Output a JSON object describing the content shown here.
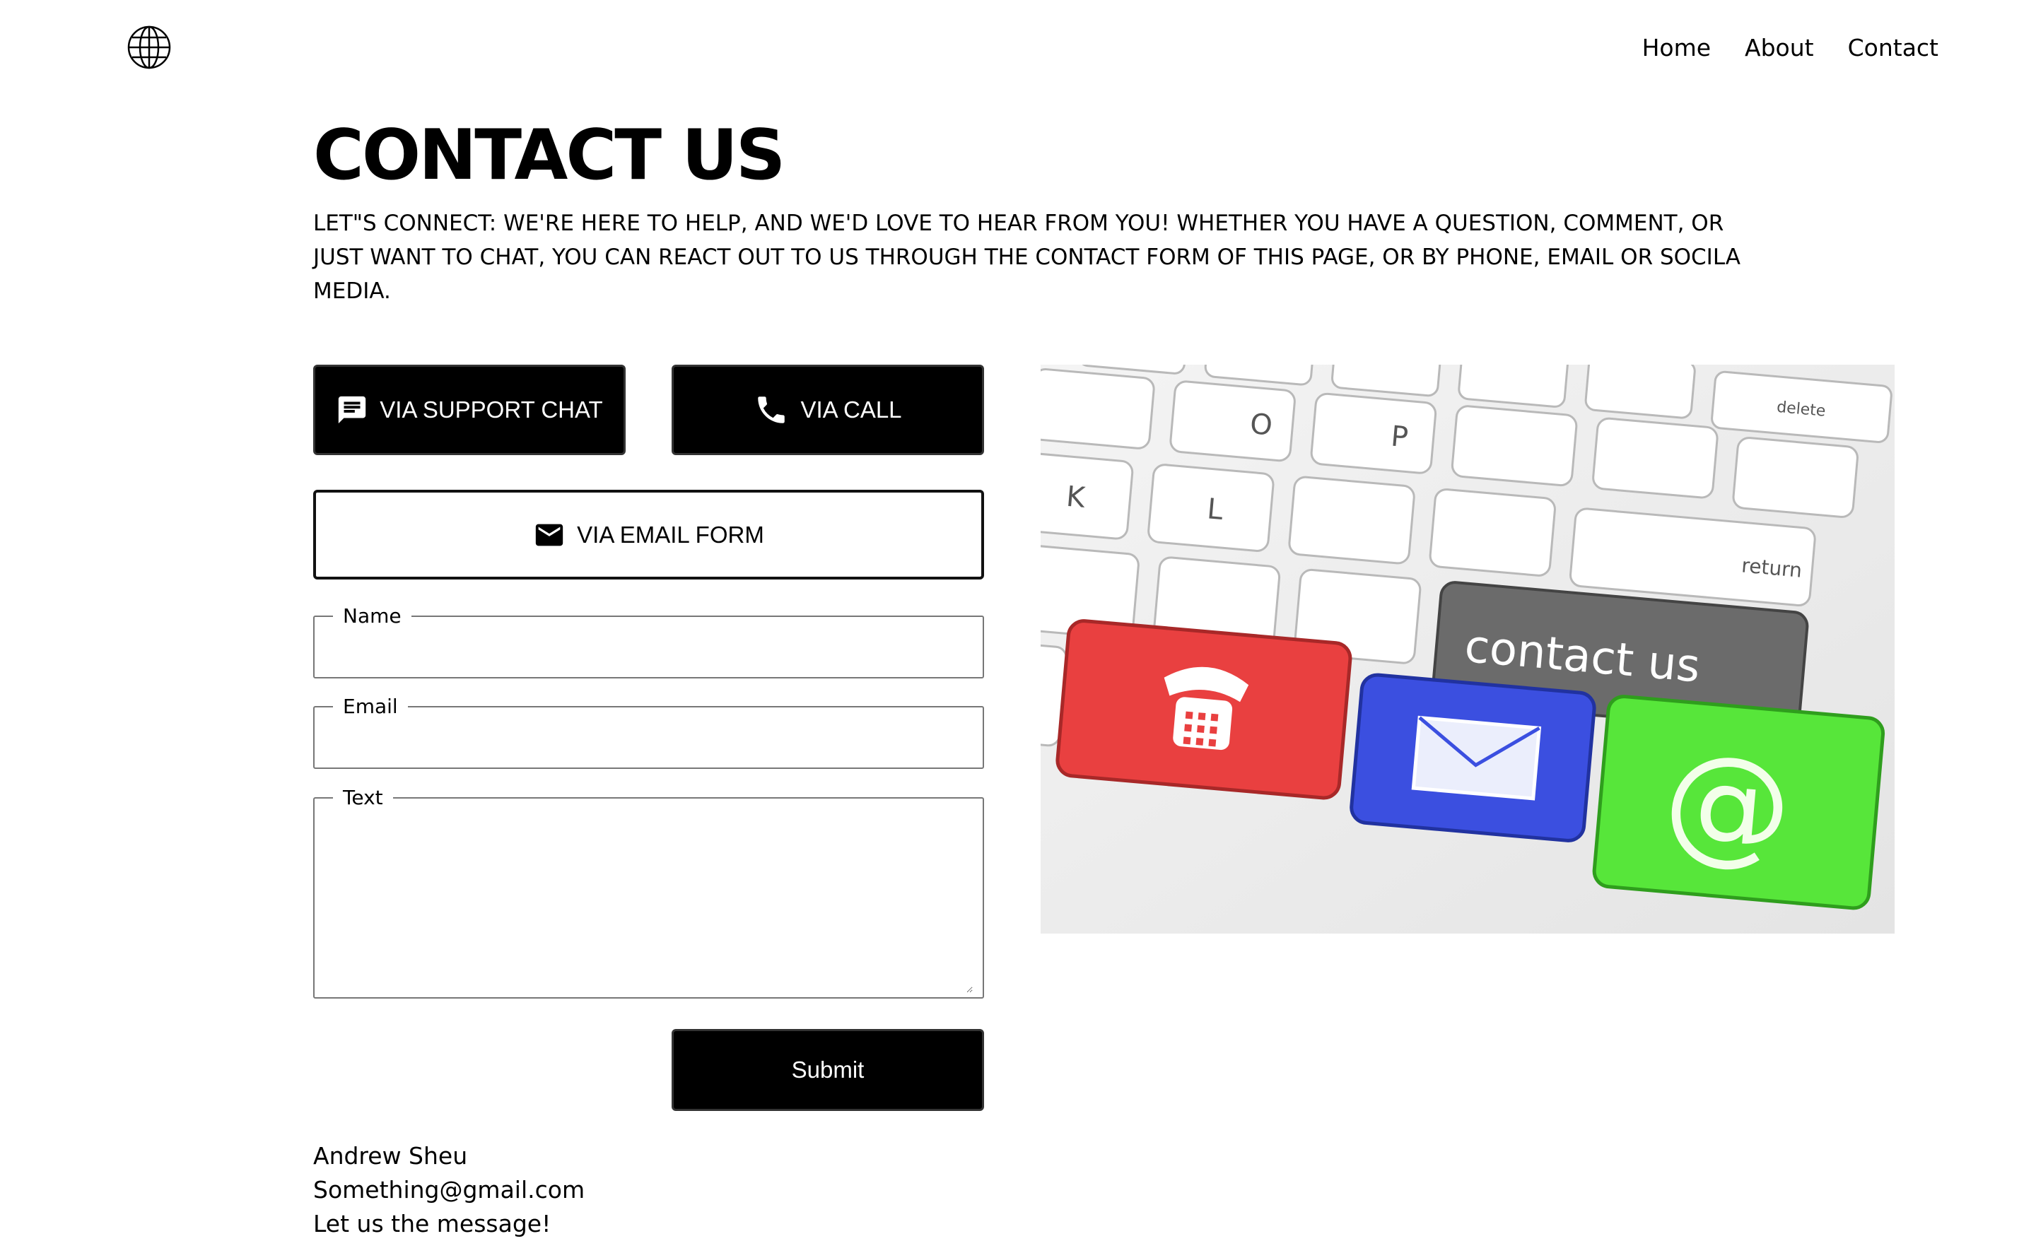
{
  "header": {
    "logo_icon": "globe-icon",
    "nav": [
      {
        "label": "Home"
      },
      {
        "label": "About"
      },
      {
        "label": "Contact"
      }
    ]
  },
  "main": {
    "title": "CONTACT US",
    "intro": "LET\"S CONNECT: WE'RE HERE TO HELP, AND WE'D LOVE TO HEAR FROM YOU! WHETHER YOU HAVE A QUESTION, COMMENT, OR JUST WANT TO CHAT, YOU CAN REACT OUT TO US THROUGH THE CONTACT FORM OF THIS PAGE, OR BY PHONE, EMAIL OR SOCILA MEDIA.",
    "buttons": {
      "support_chat": {
        "label": "VIA SUPPORT CHAT",
        "icon": "chat-icon"
      },
      "call": {
        "label": "VIA CALL",
        "icon": "phone-icon"
      },
      "email_form": {
        "label": "VIA EMAIL FORM",
        "icon": "mail-icon"
      }
    },
    "form": {
      "name": {
        "label": "Name",
        "value": ""
      },
      "email": {
        "label": "Email",
        "value": ""
      },
      "text": {
        "label": "Text",
        "value": ""
      },
      "submit_label": "Submit"
    },
    "submitted": {
      "name": "Andrew Sheu",
      "email": "Something@gmail.com",
      "message": "Let us the message!"
    },
    "hero_image": {
      "key_label": "contact us",
      "keys": [
        "delete",
        "return"
      ],
      "colors": {
        "phone_key": "#e94040",
        "mail_key": "#3b4fe0",
        "at_key": "#57e63a",
        "contact_key": "#6b6b6b"
      }
    }
  },
  "colors": {
    "background": "#ffffff",
    "primary_button": "#000000",
    "text": "#000000"
  }
}
